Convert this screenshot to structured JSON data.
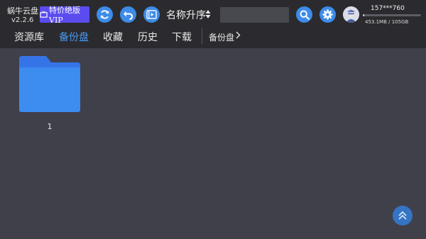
{
  "app": {
    "name": "蜗牛云盘",
    "version": "v2.2.6"
  },
  "toolbar": {
    "vip_label": "特价绝版VIP",
    "sort_label": "名称升序",
    "search_placeholder": "",
    "icons": [
      "refresh-icon",
      "back-icon",
      "video-icon",
      "search-icon",
      "gear-icon"
    ],
    "accent_color": "#3d8ce8"
  },
  "user": {
    "phone": "157***760",
    "storage_text": "453.1MB / 105GB",
    "storage_used_fraction": 0.004
  },
  "tabs": [
    {
      "label": "资源库",
      "active": false
    },
    {
      "label": "备份盘",
      "active": true
    },
    {
      "label": "收藏",
      "active": false
    },
    {
      "label": "历史",
      "active": false
    },
    {
      "label": "下载",
      "active": false
    }
  ],
  "breadcrumb": {
    "current": "备份盘"
  },
  "files": [
    {
      "name": "1",
      "type": "folder"
    }
  ]
}
